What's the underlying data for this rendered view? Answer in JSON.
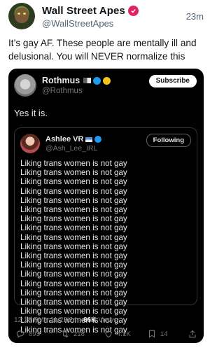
{
  "outer_post": {
    "display_name": "Wall Street Apes",
    "handle": "@WallStreetApes",
    "time_ago": "23m",
    "text": "It’s gay AF. These people are mentally ill and delusional. You will NEVER normalize this",
    "verified_color": "#e0245e"
  },
  "quoted_post": {
    "display_name": "Rothmus",
    "handle": "@Rothmus",
    "subscribe_label": "Subscribe",
    "text": "Yes it is.",
    "embedded_post": {
      "display_name": "Ashlee VR",
      "handle": "@Ash_Lee_IRL",
      "following_label": "Following",
      "lines": [
        "Liking trans women is not gay",
        "Liking trans women is not gay",
        "Liking trans women is not gay",
        "Liking trans women is not gay",
        "Liking trans women is not gay",
        "Liking trans women is not gay",
        "Liking trans women is not gay",
        "Liking trans women is not gay",
        "Liking trans women is not gay",
        "Liking trans women is not gay",
        "Liking trans women is not gay",
        "Liking trans women is not gay",
        "Liking trans women is not gay",
        "Liking trans women is not gay",
        "Liking trans women is not gay",
        "Liking trans women is not gay",
        "Liking trans women is not gay",
        "Liking trans women is not gay",
        "Liking trans women is not gay"
      ]
    },
    "timestamp": "12:18 PM · 11/22/24 ·",
    "views_count": "66K",
    "views_label": "Views",
    "actions": {
      "replies": "893",
      "reposts": "218",
      "likes": "4.1K",
      "bookmarks": "14"
    }
  },
  "icons": [
    "verified-badge-icon",
    "flag-icon",
    "blue-check-icon",
    "gold-badge-icon",
    "reply-icon",
    "repost-icon",
    "like-icon",
    "bookmark-icon",
    "share-icon"
  ]
}
